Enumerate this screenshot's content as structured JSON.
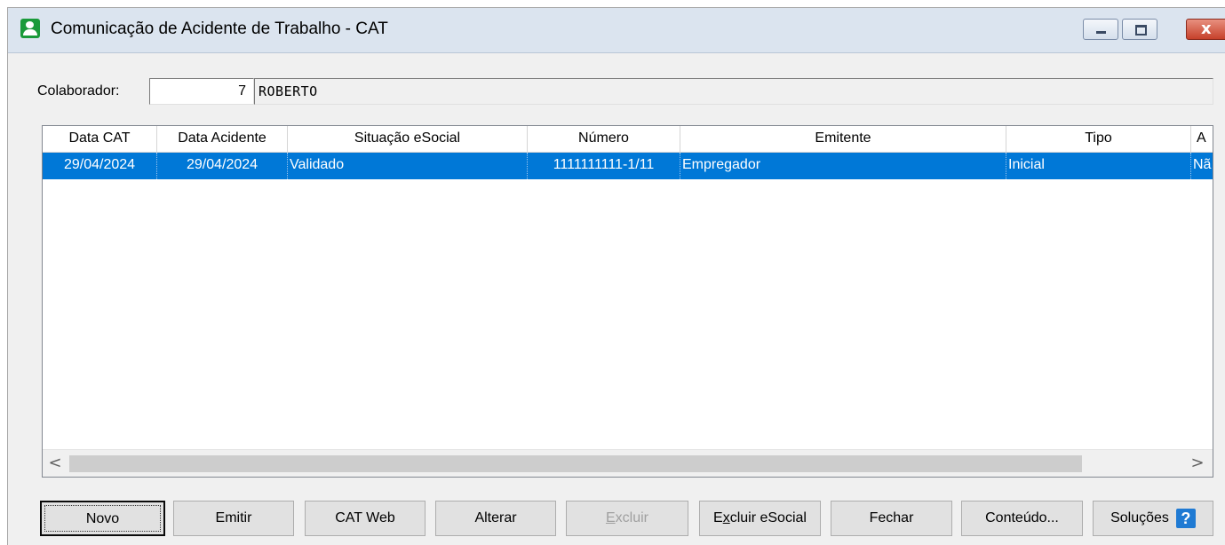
{
  "window": {
    "title": "Comunicação de Acidente de Trabalho - CAT",
    "close_glyph": "x"
  },
  "form": {
    "colaborador_label": "Colaborador:",
    "colaborador_code": "7",
    "colaborador_name": "ROBERTO"
  },
  "table": {
    "columns": [
      "Data CAT",
      "Data Acidente",
      "Situação eSocial",
      "Número",
      "Emitente",
      "Tipo",
      "A"
    ],
    "rows": [
      {
        "data_cat": "29/04/2024",
        "data_acidente": "29/04/2024",
        "situacao": "Validado",
        "numero": "1111111111-1/11",
        "emitente": "Empregador",
        "tipo": "Inicial",
        "extra": "Nã"
      }
    ],
    "selected_row_color": "#0078d7"
  },
  "scrollbar": {
    "left_arrow": "<",
    "right_arrow": ">"
  },
  "buttons": {
    "novo": "Novo",
    "emitir": "Emitir",
    "cat_web": "CAT Web",
    "alterar": "Alterar",
    "excluir_first": "E",
    "excluir_rest": "xcluir",
    "excluir_esocial_first": "E",
    "excluir_esocial_mid": "x",
    "excluir_esocial_rest": "cluir eSocial",
    "fechar": "Fechar",
    "conteudo": "Conteúdo...",
    "solucoes": "Soluções",
    "help_glyph": "?"
  },
  "icons": {
    "app": "user-icon",
    "minimize": "minimize-icon",
    "maximize": "maximize-icon",
    "close": "close-icon",
    "help": "help-icon"
  }
}
